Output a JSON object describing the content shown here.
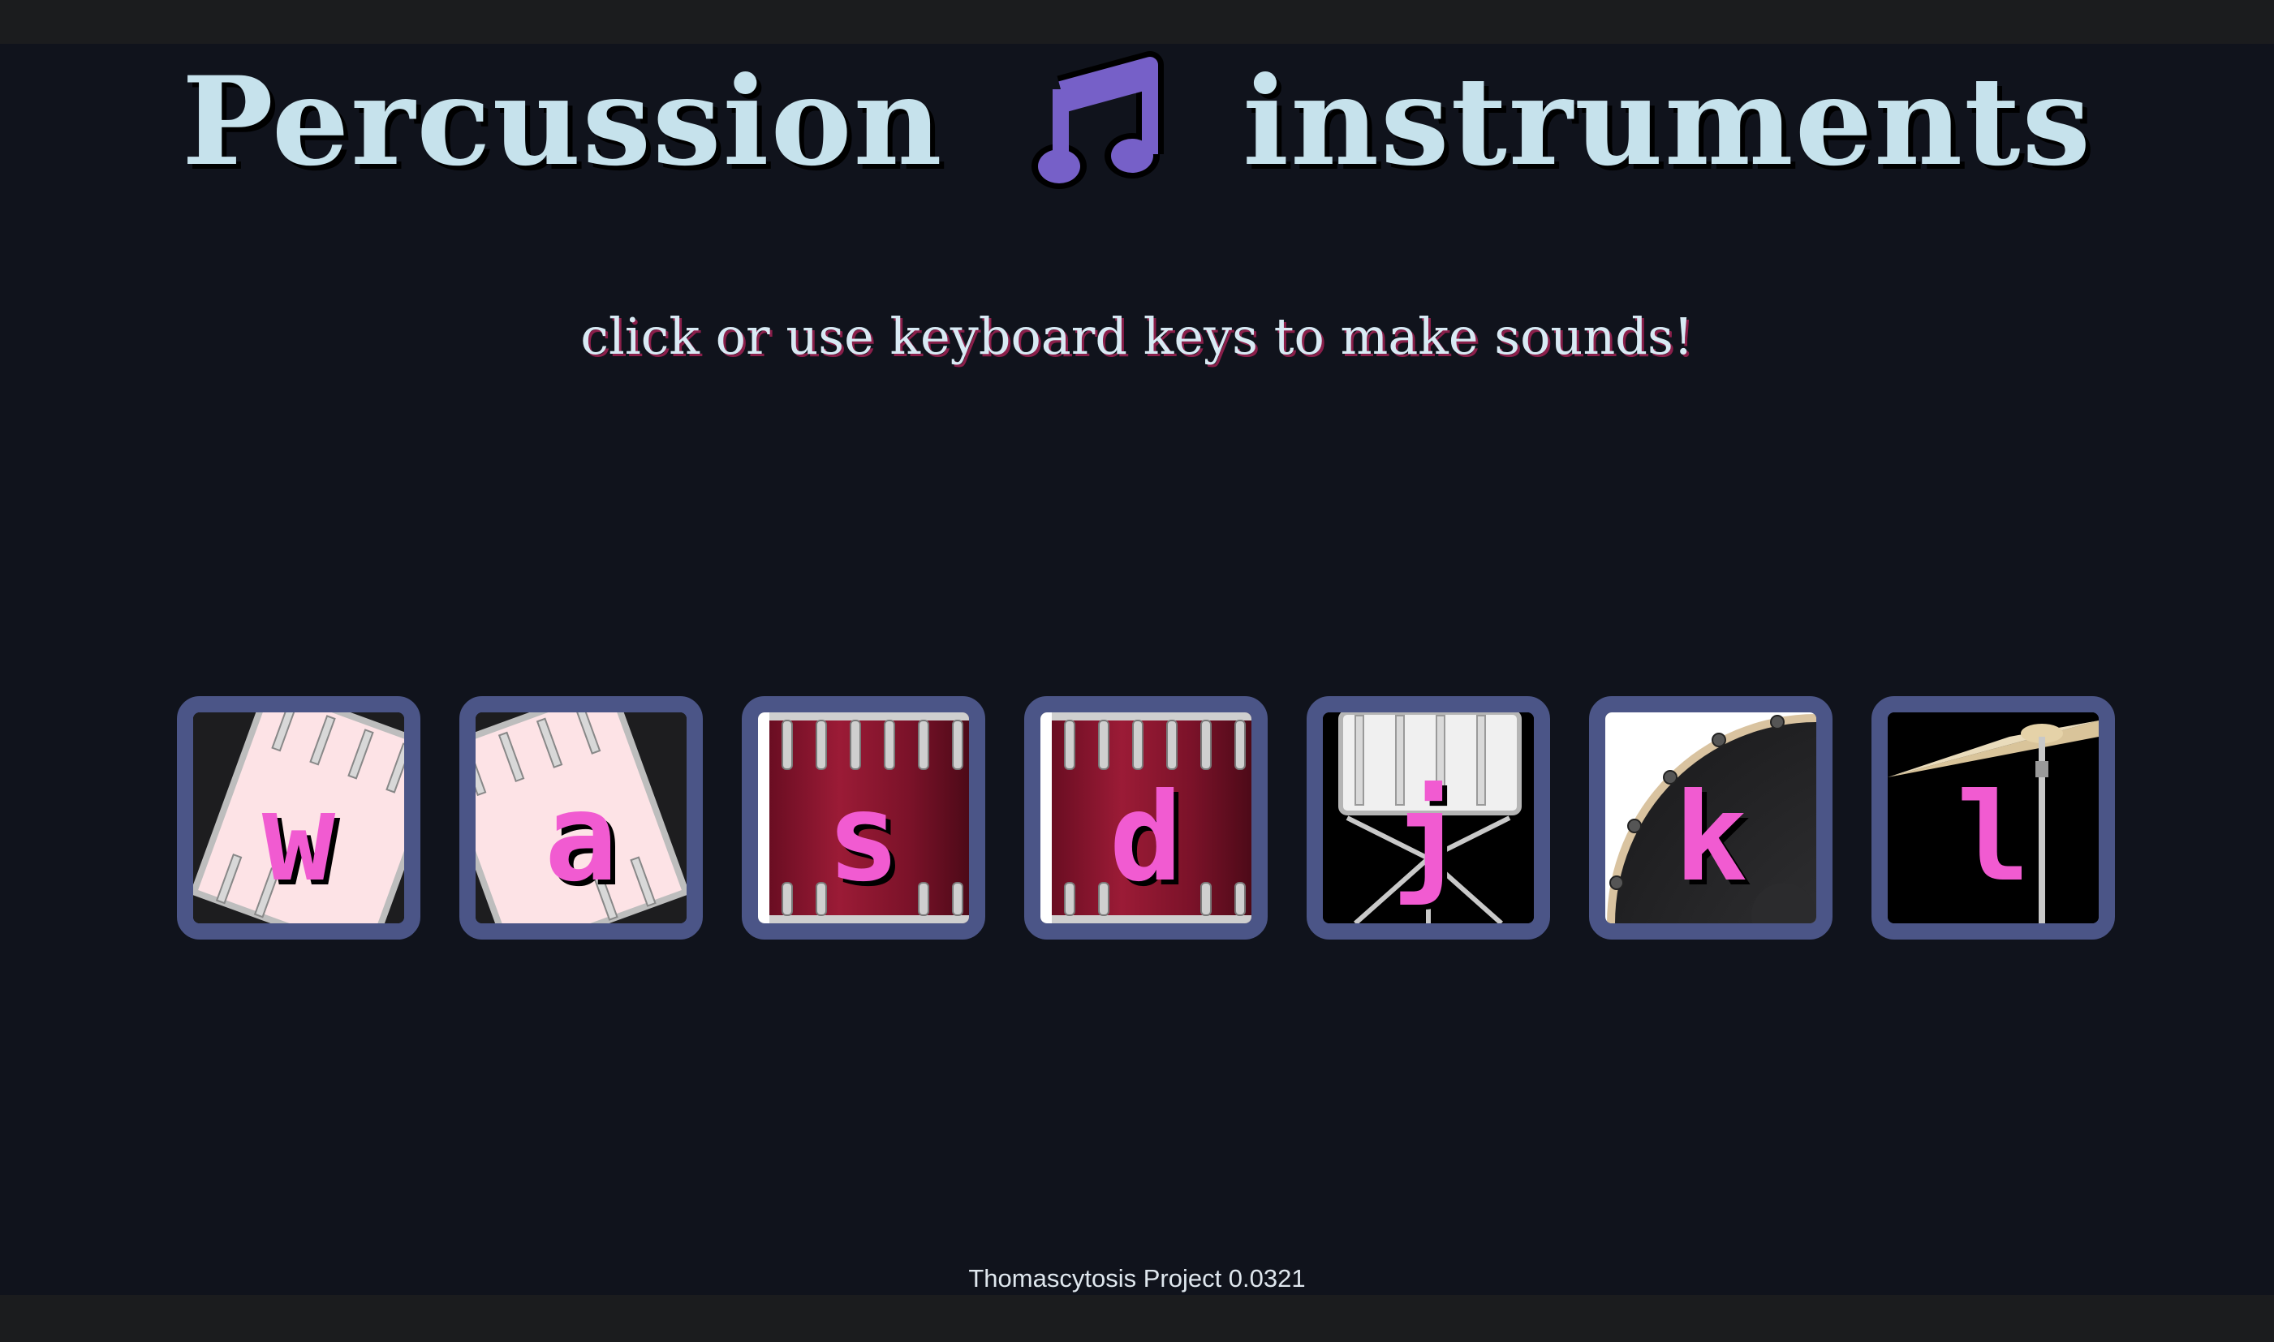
{
  "header": {
    "title_left": "Percussion",
    "title_icon": "musical-notes-icon",
    "title_right": "instruments",
    "subtitle": "click or use keyboard keys to make sounds!"
  },
  "pads": [
    {
      "key": "w",
      "instrument_icon": "tom-drum-tilted-left"
    },
    {
      "key": "a",
      "instrument_icon": "tom-drum-tilted-right"
    },
    {
      "key": "s",
      "instrument_icon": "floor-tom-red"
    },
    {
      "key": "d",
      "instrument_icon": "floor-tom-red"
    },
    {
      "key": "j",
      "instrument_icon": "snare-drum-white"
    },
    {
      "key": "k",
      "instrument_icon": "bass-drum-black"
    },
    {
      "key": "l",
      "instrument_icon": "cymbal"
    }
  ],
  "footer": {
    "text": "Thomascytosis Project 0.0321"
  },
  "colors": {
    "background": "#10131c",
    "title": "#c6e2ec",
    "pad_border": "#4b5587",
    "key_letter": "#f15bd1",
    "note_icon": "#7660c8"
  }
}
